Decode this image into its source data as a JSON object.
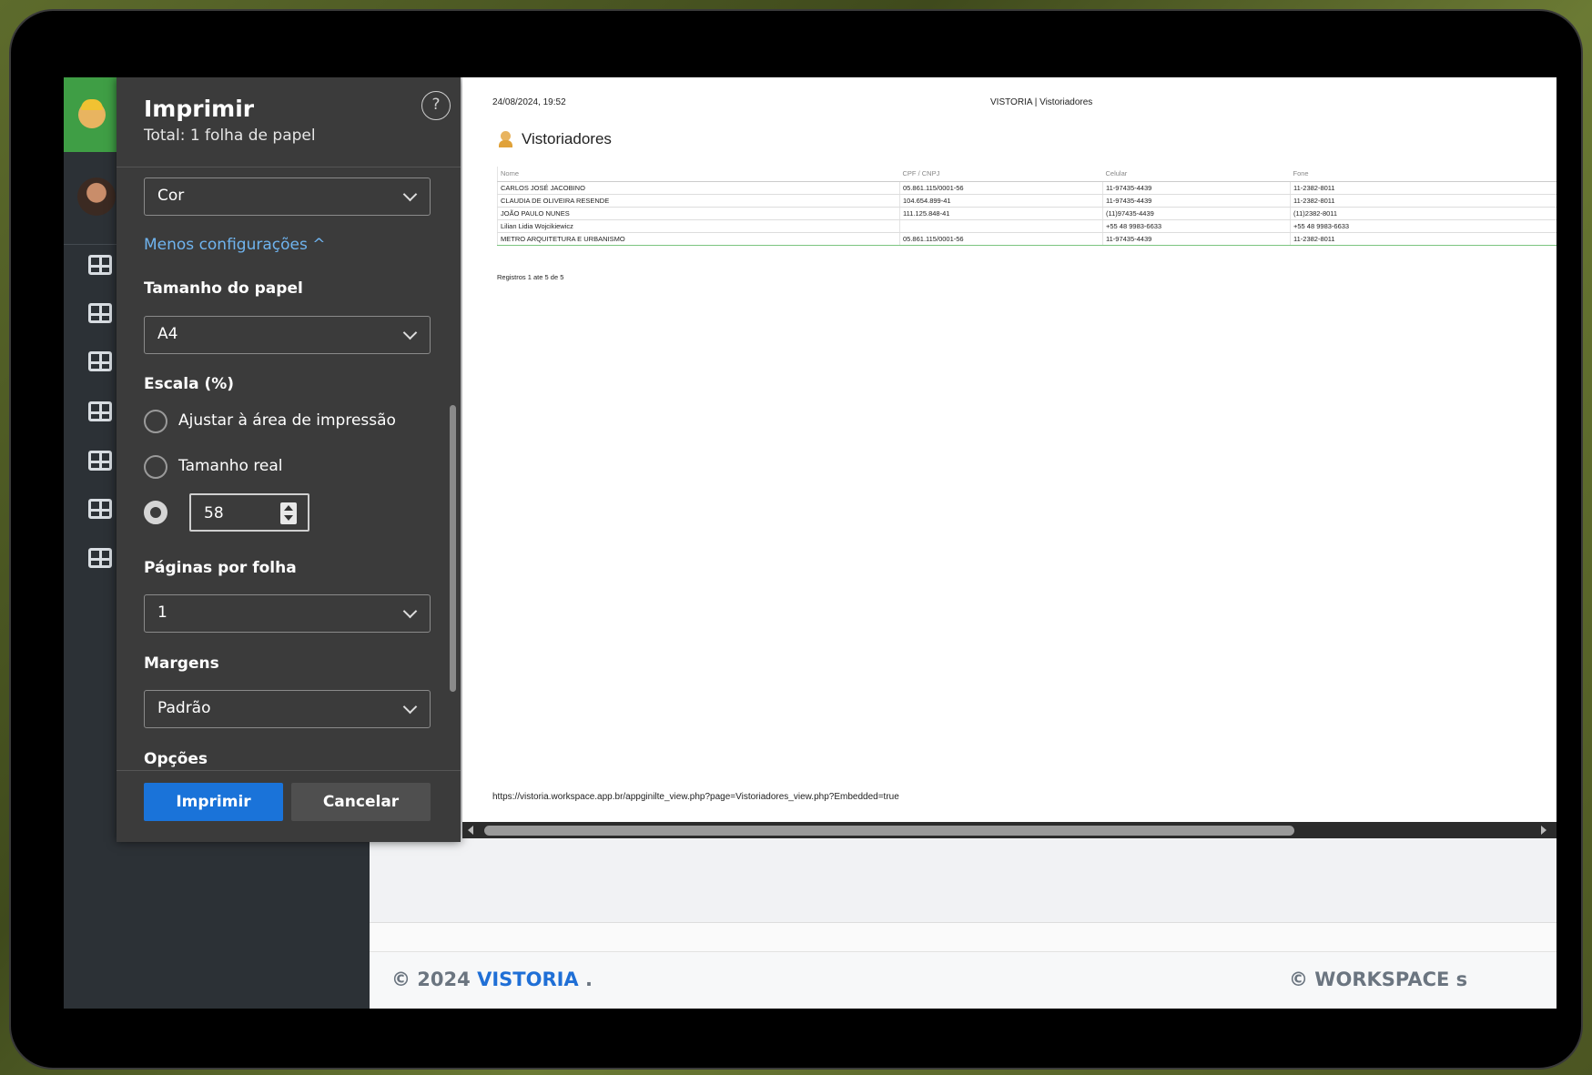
{
  "dialog": {
    "title": "Imprimir",
    "subtitle": "Total: 1 folha de papel",
    "help": "?",
    "color_select": "Cor",
    "less_settings": "Menos configurações ^",
    "paper_size_label": "Tamanho do papel",
    "paper_size": "A4",
    "scale_label": "Escala (%)",
    "scale_fit": "Ajustar à área de impressão",
    "scale_actual": "Tamanho real",
    "scale_value": "58",
    "pages_per_sheet_label": "Páginas por folha",
    "pages_per_sheet": "1",
    "margins_label": "Margens",
    "margins": "Padrão",
    "options_label": "Opções",
    "print_button": "Imprimir",
    "cancel_button": "Cancelar"
  },
  "preview": {
    "date": "24/08/2024, 19:52",
    "header": "VISTORIA | Vistoriadores",
    "title": "Vistoriadores",
    "columns": [
      "Nome",
      "CPF / CNPJ",
      "Celular",
      "Fone"
    ],
    "rows": [
      [
        "CARLOS JOSÉ JACOBINO",
        "05.861.115/0001-56",
        "11-97435-4439",
        "11-2382-8011"
      ],
      [
        "CLAUDIA DE OLIVEIRA RESENDE",
        "104.654.899-41",
        "11-97435-4439",
        "11-2382-8011"
      ],
      [
        "JOÃO PAULO NUNES",
        "111.125.848-41",
        "(11)97435-4439",
        "(11)2382-8011"
      ],
      [
        "Lilian Lidia Wojcikiewicz",
        "",
        "+55 48 9983-6633",
        "+55 48 9983-6633"
      ],
      [
        "METRO ARQUITETURA E URBANISMO",
        "05.861.115/0001-56",
        "11-97435-4439",
        "11-2382-8011"
      ]
    ],
    "records": "Registros 1 ate 5 de 5",
    "url": "https://vistoria.workspace.app.br/appginilte_view.php?page=Vistoriadores_view.php?Embedded=true"
  },
  "footer": {
    "left_prefix": "© 2024 ",
    "brand": "VISTORIA",
    "left_suffix": " .",
    "right": "© WORKSPACE s"
  }
}
